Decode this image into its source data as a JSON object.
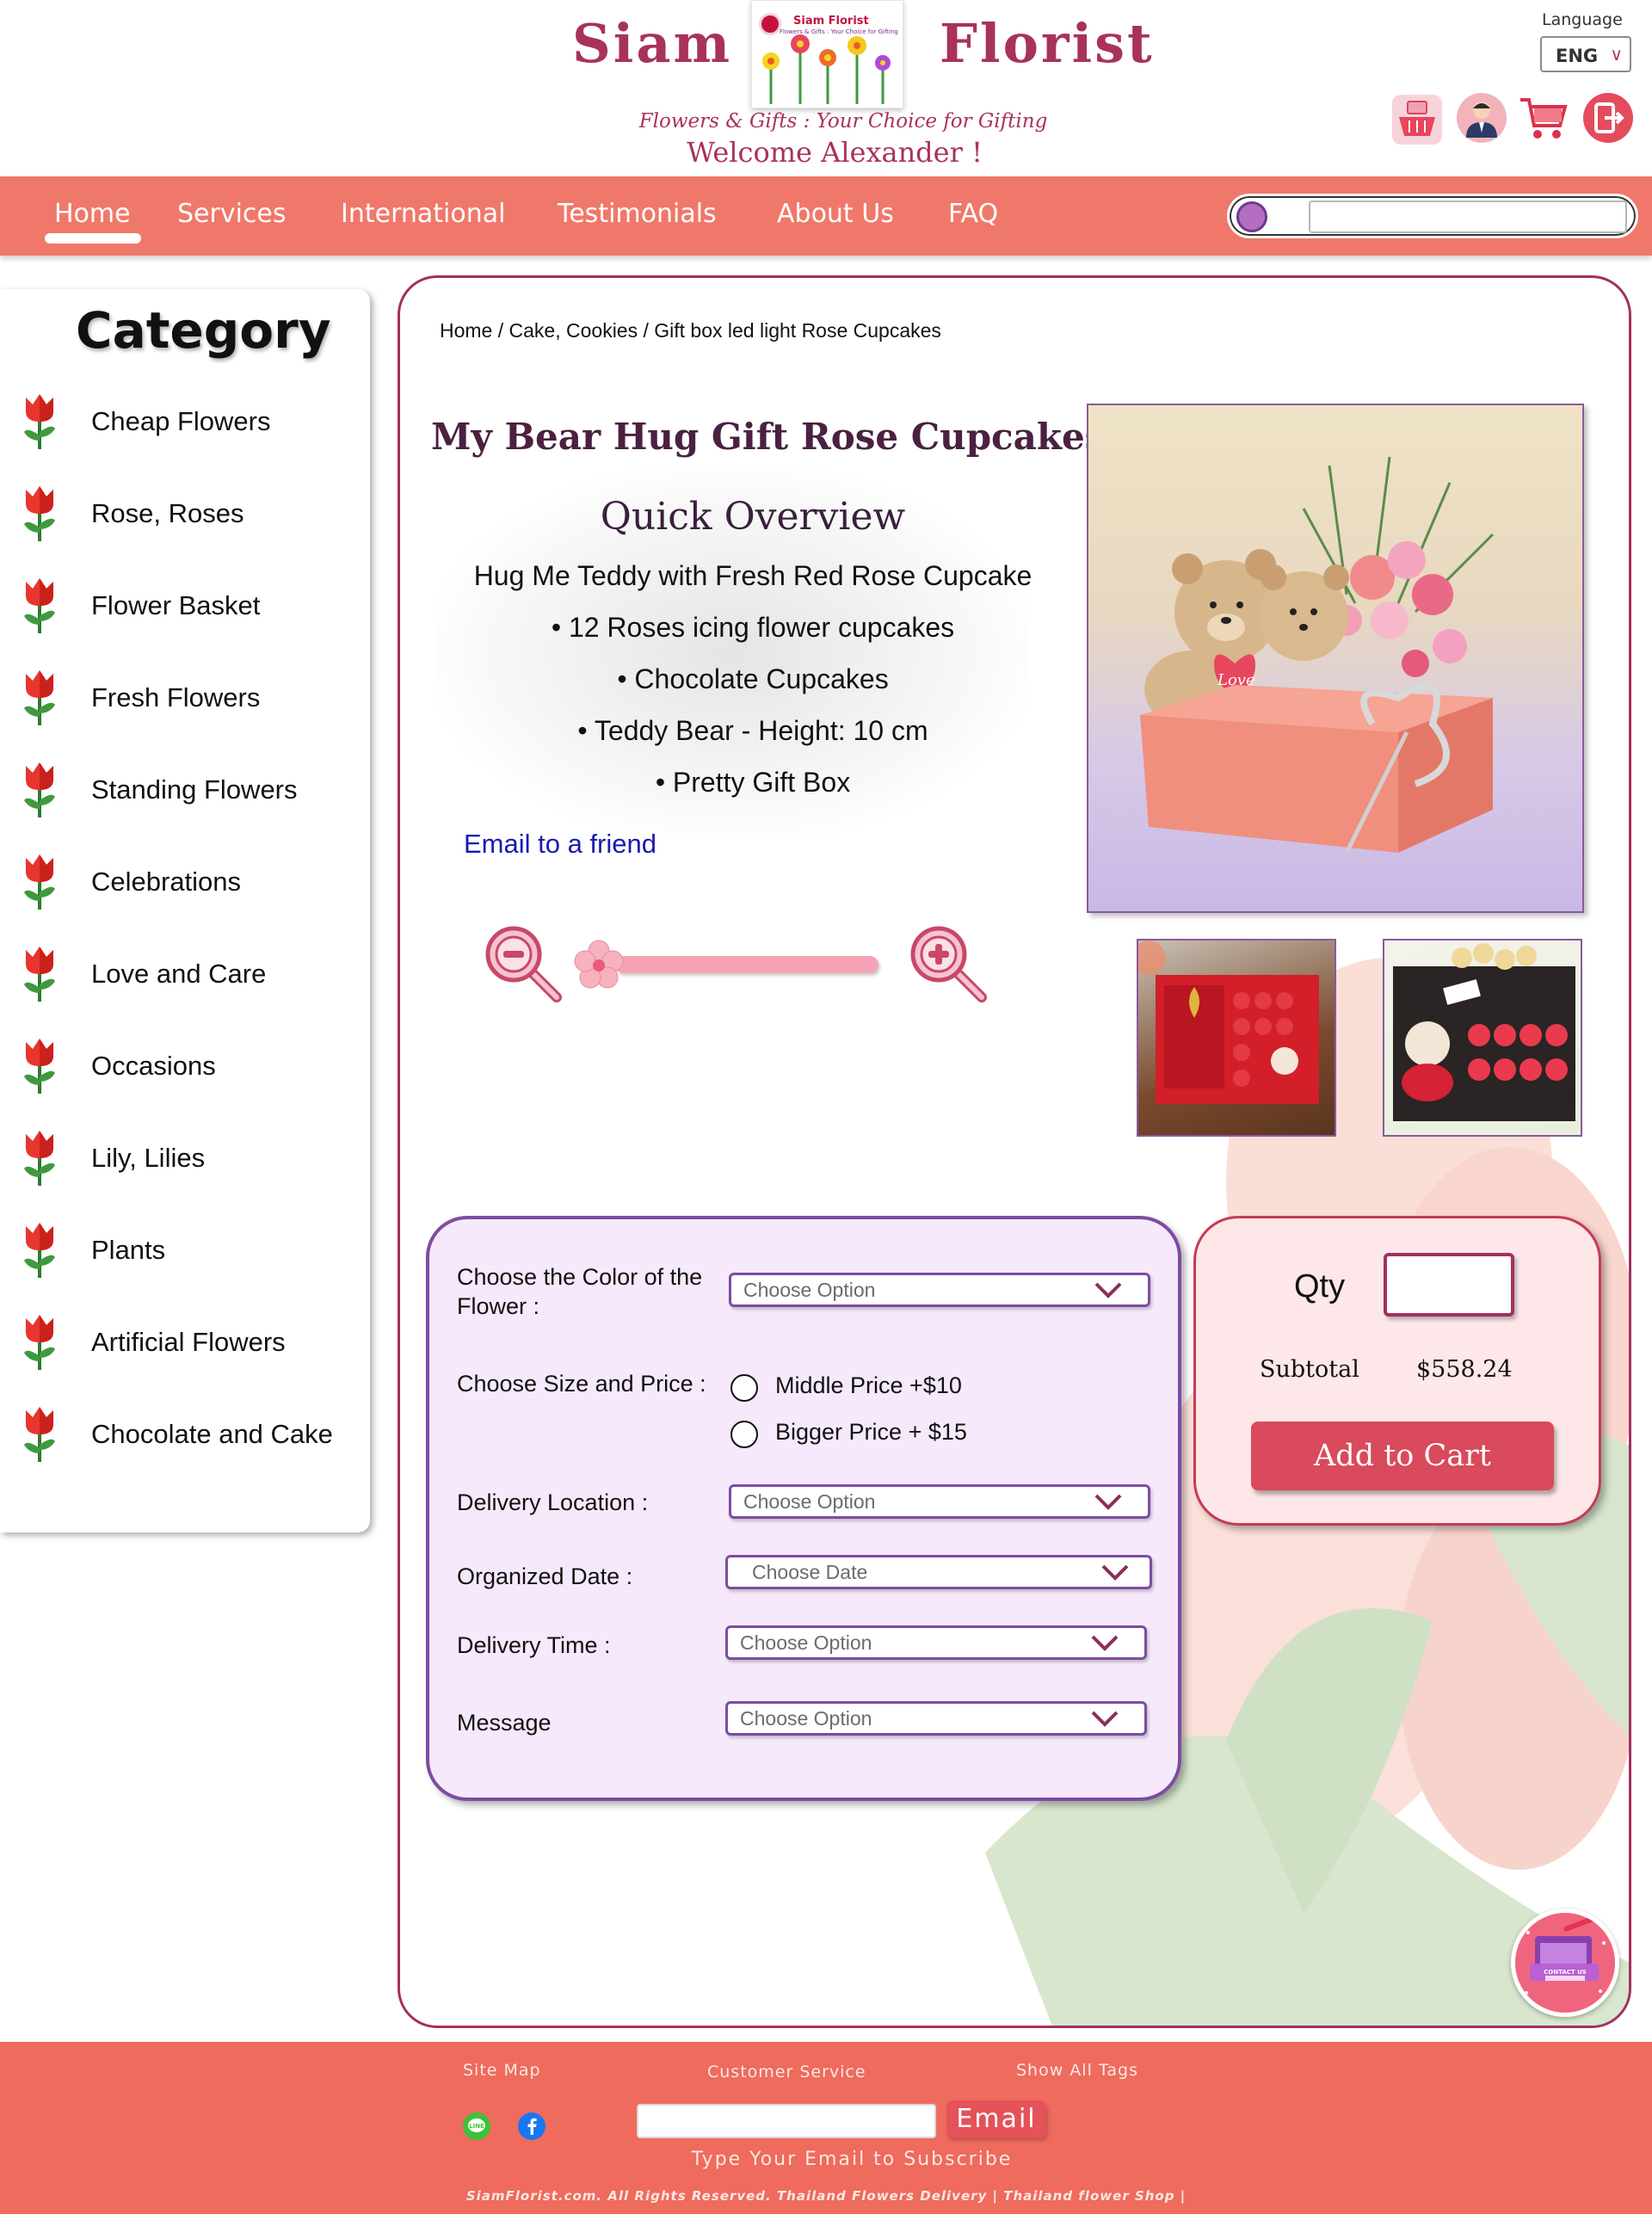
{
  "header": {
    "brand_left": "Siam",
    "brand_right": "Florist",
    "logo_title": "Siam Florist",
    "logo_subtitle": "Flowers & Gifts : Your Choice for Gifting",
    "tagline": "Flowers & Gifts : Your Choice for Gifting",
    "welcome": "Welcome Alexander !",
    "language_label": "Language",
    "language_value": "ENG",
    "icons": [
      "basket-icon",
      "user-icon",
      "cart-icon",
      "logout-icon"
    ]
  },
  "nav": {
    "items": [
      "Home",
      "Services",
      "International",
      "Testimonials",
      "About Us",
      "FAQ"
    ],
    "active": "Home",
    "search_placeholder": ""
  },
  "sidebar": {
    "title": "Category",
    "items": [
      "Cheap Flowers",
      "Rose, Roses",
      "Flower Basket",
      "Fresh Flowers",
      "Standing Flowers",
      "Celebrations",
      "Love and Care",
      "Occasions",
      "Lily, Lilies",
      "Plants",
      "Artificial Flowers",
      "Chocolate and Cake"
    ]
  },
  "product": {
    "breadcrumb": "Home / Cake, Cookies / Gift box led light Rose Cupcakes",
    "title": "My Bear Hug Gift Rose Cupcakes",
    "overview_title": "Quick Overview",
    "overview_lines": [
      "Hug Me Teddy with Fresh Red Rose Cupcake",
      "•  12 Roses icing flower cupcakes",
      "•  Chocolate Cupcakes",
      "•  Teddy Bear - Height: 10 cm",
      "•  Pretty Gift Box"
    ],
    "email_friend": "Email to a friend",
    "image_text": "Love"
  },
  "options": {
    "color_label": "Choose the Color of the Flower :",
    "color_placeholder": "Choose Option",
    "size_label": "Choose Size and Price :",
    "size_options": [
      "Middle Price +$10",
      "Bigger Price + $15"
    ],
    "location_label": "Delivery Location :",
    "location_placeholder": "Choose Option",
    "date_label": "Organized Date :",
    "date_placeholder": "Choose Date",
    "time_label": "Delivery Time :",
    "time_placeholder": "Choose Option",
    "message_label": "Message",
    "message_placeholder": "Choose Option"
  },
  "cart": {
    "qty_label": "Qty",
    "qty_value": "",
    "subtotal_label": "Subtotal",
    "subtotal_value": "$558.24",
    "add_button": "Add to Cart"
  },
  "contact_badge": "CONTACT US",
  "footer": {
    "site_map": "Site Map",
    "customer_service": "Customer Service",
    "show_all_tags": "Show All Tags",
    "email_button": "Email",
    "subscribe_text": "Type Your Email to Subscribe",
    "copyright": "SiamFlorist.com. All Rights Reserved. Thailand Flowers Delivery | Thailand flower Shop |"
  },
  "colors": {
    "brand": "#a8325c",
    "nav": "#f0786a",
    "footer": "#ee6b5d",
    "options_bg": "#f6e9fb",
    "options_border": "#7d4ca3",
    "qty_bg": "#fde7e9",
    "button": "#d94a5c",
    "link": "#1a1ab0"
  }
}
